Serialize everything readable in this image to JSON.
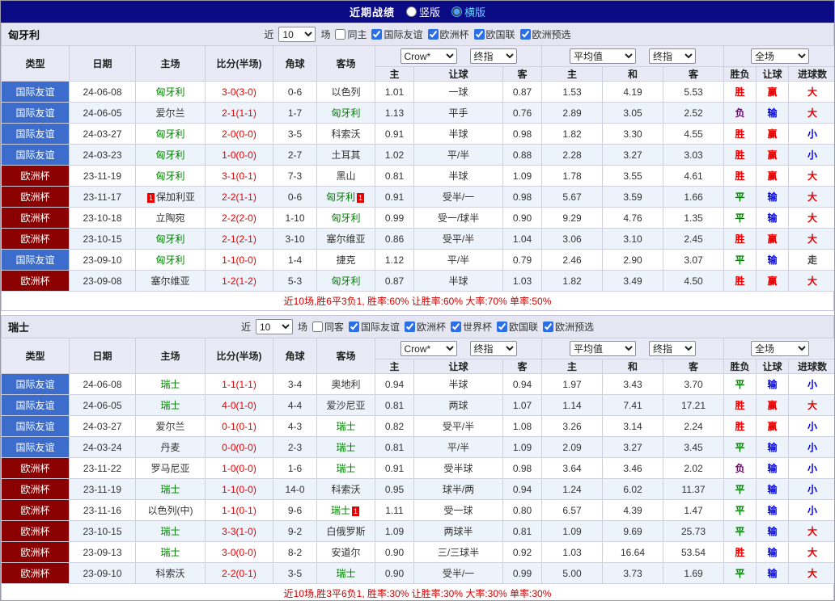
{
  "topbar": {
    "title": "近期战绩",
    "vertical_label": "竖版",
    "horizontal_label": "横版",
    "vertical_checked": false,
    "horizontal_checked": true
  },
  "filter_words": {
    "near": "近",
    "count": "10",
    "games": "场"
  },
  "odds_headers": {
    "company": "Crow*",
    "final": "终指",
    "average": "平均值",
    "final2": "终指",
    "full": "全场"
  },
  "columns": [
    "类型",
    "日期",
    "主场",
    "比分(半场)",
    "角球",
    "客场",
    "主",
    "让球",
    "客",
    "主",
    "和",
    "客",
    "胜负",
    "让球",
    "进球数"
  ],
  "sections": [
    {
      "team": "匈牙利",
      "filter": {
        "same_label": "同主",
        "same_checked": false,
        "competitions": [
          {
            "label": "国际友谊",
            "checked": true
          },
          {
            "label": "欧洲杯",
            "checked": true
          },
          {
            "label": "欧国联",
            "checked": true
          },
          {
            "label": "欧洲预选",
            "checked": true
          }
        ]
      },
      "rows": [
        {
          "type": "国际友谊",
          "tc": "friendly",
          "date": "24-06-08",
          "home": "匈牙利",
          "hf": true,
          "hc": 0,
          "score": "3-0(3-0)",
          "corner": "0-6",
          "away": "以色列",
          "af": false,
          "ac": 0,
          "o1": "1.01",
          "line": "一球",
          "o2": "0.87",
          "eh": "1.53",
          "ed": "4.19",
          "ea": "5.53",
          "r": "胜",
          "rc": "win",
          "hr": "赢",
          "hrc": "win",
          "g": "大",
          "gc": "big"
        },
        {
          "type": "国际友谊",
          "tc": "friendly",
          "date": "24-06-05",
          "home": "爱尔兰",
          "hf": false,
          "hc": 0,
          "score": "2-1(1-1)",
          "corner": "1-7",
          "away": "匈牙利",
          "af": true,
          "ac": 0,
          "o1": "1.13",
          "line": "平手",
          "o2": "0.76",
          "eh": "2.89",
          "ed": "3.05",
          "ea": "2.52",
          "r": "负",
          "rc": "lose",
          "hr": "输",
          "hrc": "lose",
          "g": "大",
          "gc": "big"
        },
        {
          "type": "国际友谊",
          "tc": "friendly",
          "date": "24-03-27",
          "home": "匈牙利",
          "hf": true,
          "hc": 0,
          "score": "2-0(0-0)",
          "corner": "3-5",
          "away": "科索沃",
          "af": false,
          "ac": 0,
          "o1": "0.91",
          "line": "半球",
          "o2": "0.98",
          "eh": "1.82",
          "ed": "3.30",
          "ea": "4.55",
          "r": "胜",
          "rc": "win",
          "hr": "赢",
          "hrc": "win",
          "g": "小",
          "gc": "small"
        },
        {
          "type": "国际友谊",
          "tc": "friendly",
          "date": "24-03-23",
          "home": "匈牙利",
          "hf": true,
          "hc": 0,
          "score": "1-0(0-0)",
          "corner": "2-7",
          "away": "土耳其",
          "af": false,
          "ac": 0,
          "o1": "1.02",
          "line": "平/半",
          "o2": "0.88",
          "eh": "2.28",
          "ed": "3.27",
          "ea": "3.03",
          "r": "胜",
          "rc": "win",
          "hr": "赢",
          "hrc": "win",
          "g": "小",
          "gc": "small"
        },
        {
          "type": "欧洲杯",
          "tc": "euro",
          "date": "23-11-19",
          "home": "匈牙利",
          "hf": true,
          "hc": 0,
          "score": "3-1(0-1)",
          "corner": "7-3",
          "away": "黑山",
          "af": false,
          "ac": 0,
          "o1": "0.81",
          "line": "半球",
          "o2": "1.09",
          "eh": "1.78",
          "ed": "3.55",
          "ea": "4.61",
          "r": "胜",
          "rc": "win",
          "hr": "赢",
          "hrc": "win",
          "g": "大",
          "gc": "big"
        },
        {
          "type": "欧洲杯",
          "tc": "euro",
          "date": "23-11-17",
          "home": "保加利亚",
          "hf": false,
          "hc": 1,
          "score": "2-2(1-1)",
          "corner": "0-6",
          "away": "匈牙利",
          "af": true,
          "ac": 1,
          "o1": "0.91",
          "line": "受半/一",
          "o2": "0.98",
          "eh": "5.67",
          "ed": "3.59",
          "ea": "1.66",
          "r": "平",
          "rc": "draw",
          "hr": "输",
          "hrc": "lose",
          "g": "大",
          "gc": "big"
        },
        {
          "type": "欧洲杯",
          "tc": "euro",
          "date": "23-10-18",
          "home": "立陶宛",
          "hf": false,
          "hc": 0,
          "score": "2-2(2-0)",
          "corner": "1-10",
          "away": "匈牙利",
          "af": true,
          "ac": 0,
          "o1": "0.99",
          "line": "受一/球半",
          "o2": "0.90",
          "eh": "9.29",
          "ed": "4.76",
          "ea": "1.35",
          "r": "平",
          "rc": "draw",
          "hr": "输",
          "hrc": "lose",
          "g": "大",
          "gc": "big"
        },
        {
          "type": "欧洲杯",
          "tc": "euro",
          "date": "23-10-15",
          "home": "匈牙利",
          "hf": true,
          "hc": 0,
          "score": "2-1(2-1)",
          "corner": "3-10",
          "away": "塞尔维亚",
          "af": false,
          "ac": 0,
          "o1": "0.86",
          "line": "受平/半",
          "o2": "1.04",
          "eh": "3.06",
          "ed": "3.10",
          "ea": "2.45",
          "r": "胜",
          "rc": "win",
          "hr": "赢",
          "hrc": "win",
          "g": "大",
          "gc": "big"
        },
        {
          "type": "国际友谊",
          "tc": "friendly",
          "date": "23-09-10",
          "home": "匈牙利",
          "hf": true,
          "hc": 0,
          "score": "1-1(0-0)",
          "corner": "1-4",
          "away": "捷克",
          "af": false,
          "ac": 0,
          "o1": "1.12",
          "line": "平/半",
          "o2": "0.79",
          "eh": "2.46",
          "ed": "2.90",
          "ea": "3.07",
          "r": "平",
          "rc": "draw",
          "hr": "输",
          "hrc": "lose",
          "g": "走",
          "gc": "push"
        },
        {
          "type": "欧洲杯",
          "tc": "euro",
          "date": "23-09-08",
          "home": "塞尔维亚",
          "hf": false,
          "hc": 0,
          "score": "1-2(1-2)",
          "corner": "5-3",
          "away": "匈牙利",
          "af": true,
          "ac": 0,
          "o1": "0.87",
          "line": "半球",
          "o2": "1.03",
          "eh": "1.82",
          "ed": "3.49",
          "ea": "4.50",
          "r": "胜",
          "rc": "win",
          "hr": "赢",
          "hrc": "win",
          "g": "大",
          "gc": "big"
        }
      ],
      "summary": "近10场,胜6平3负1, 胜率:60% 让胜率:60% 大率:70% 单率:50%"
    },
    {
      "team": "瑞士",
      "filter": {
        "same_label": "同客",
        "same_checked": false,
        "competitions": [
          {
            "label": "国际友谊",
            "checked": true
          },
          {
            "label": "欧洲杯",
            "checked": true
          },
          {
            "label": "世界杯",
            "checked": true
          },
          {
            "label": "欧国联",
            "checked": true
          },
          {
            "label": "欧洲预选",
            "checked": true
          }
        ]
      },
      "rows": [
        {
          "type": "国际友谊",
          "tc": "friendly",
          "date": "24-06-08",
          "home": "瑞士",
          "hf": true,
          "hc": 0,
          "score": "1-1(1-1)",
          "corner": "3-4",
          "away": "奥地利",
          "af": false,
          "ac": 0,
          "o1": "0.94",
          "line": "半球",
          "o2": "0.94",
          "eh": "1.97",
          "ed": "3.43",
          "ea": "3.70",
          "r": "平",
          "rc": "draw",
          "hr": "输",
          "hrc": "lose",
          "g": "小",
          "gc": "small"
        },
        {
          "type": "国际友谊",
          "tc": "friendly",
          "date": "24-06-05",
          "home": "瑞士",
          "hf": true,
          "hc": 0,
          "score": "4-0(1-0)",
          "corner": "4-4",
          "away": "爱沙尼亚",
          "af": false,
          "ac": 0,
          "o1": "0.81",
          "line": "两球",
          "o2": "1.07",
          "eh": "1.14",
          "ed": "7.41",
          "ea": "17.21",
          "r": "胜",
          "rc": "win",
          "hr": "赢",
          "hrc": "win",
          "g": "大",
          "gc": "big"
        },
        {
          "type": "国际友谊",
          "tc": "friendly",
          "date": "24-03-27",
          "home": "爱尔兰",
          "hf": false,
          "hc": 0,
          "score": "0-1(0-1)",
          "corner": "4-3",
          "away": "瑞士",
          "af": true,
          "ac": 0,
          "o1": "0.82",
          "line": "受平/半",
          "o2": "1.08",
          "eh": "3.26",
          "ed": "3.14",
          "ea": "2.24",
          "r": "胜",
          "rc": "win",
          "hr": "赢",
          "hrc": "win",
          "g": "小",
          "gc": "small"
        },
        {
          "type": "国际友谊",
          "tc": "friendly",
          "date": "24-03-24",
          "home": "丹麦",
          "hf": false,
          "hc": 0,
          "score": "0-0(0-0)",
          "corner": "2-3",
          "away": "瑞士",
          "af": true,
          "ac": 0,
          "o1": "0.81",
          "line": "平/半",
          "o2": "1.09",
          "eh": "2.09",
          "ed": "3.27",
          "ea": "3.45",
          "r": "平",
          "rc": "draw",
          "hr": "输",
          "hrc": "lose",
          "g": "小",
          "gc": "small"
        },
        {
          "type": "欧洲杯",
          "tc": "euro",
          "date": "23-11-22",
          "home": "罗马尼亚",
          "hf": false,
          "hc": 0,
          "score": "1-0(0-0)",
          "corner": "1-6",
          "away": "瑞士",
          "af": true,
          "ac": 0,
          "o1": "0.91",
          "line": "受半球",
          "o2": "0.98",
          "eh": "3.64",
          "ed": "3.46",
          "ea": "2.02",
          "r": "负",
          "rc": "lose",
          "hr": "输",
          "hrc": "lose",
          "g": "小",
          "gc": "small"
        },
        {
          "type": "欧洲杯",
          "tc": "euro",
          "date": "23-11-19",
          "home": "瑞士",
          "hf": true,
          "hc": 0,
          "score": "1-1(0-0)",
          "corner": "14-0",
          "away": "科索沃",
          "af": false,
          "ac": 0,
          "o1": "0.95",
          "line": "球半/两",
          "o2": "0.94",
          "eh": "1.24",
          "ed": "6.02",
          "ea": "11.37",
          "r": "平",
          "rc": "draw",
          "hr": "输",
          "hrc": "lose",
          "g": "小",
          "gc": "small"
        },
        {
          "type": "欧洲杯",
          "tc": "euro",
          "date": "23-11-16",
          "home": "以色列(中)",
          "hf": false,
          "hc": 0,
          "score": "1-1(0-1)",
          "corner": "9-6",
          "away": "瑞士",
          "af": true,
          "ac": 1,
          "o1": "1.11",
          "line": "受一球",
          "o2": "0.80",
          "eh": "6.57",
          "ed": "4.39",
          "ea": "1.47",
          "r": "平",
          "rc": "draw",
          "hr": "输",
          "hrc": "lose",
          "g": "小",
          "gc": "small"
        },
        {
          "type": "欧洲杯",
          "tc": "euro",
          "date": "23-10-15",
          "home": "瑞士",
          "hf": true,
          "hc": 0,
          "score": "3-3(1-0)",
          "corner": "9-2",
          "away": "白俄罗斯",
          "af": false,
          "ac": 0,
          "o1": "1.09",
          "line": "两球半",
          "o2": "0.81",
          "eh": "1.09",
          "ed": "9.69",
          "ea": "25.73",
          "r": "平",
          "rc": "draw",
          "hr": "输",
          "hrc": "lose",
          "g": "大",
          "gc": "big"
        },
        {
          "type": "欧洲杯",
          "tc": "euro",
          "date": "23-09-13",
          "home": "瑞士",
          "hf": true,
          "hc": 0,
          "score": "3-0(0-0)",
          "corner": "8-2",
          "away": "安道尔",
          "af": false,
          "ac": 0,
          "o1": "0.90",
          "line": "三/三球半",
          "o2": "0.92",
          "eh": "1.03",
          "ed": "16.64",
          "ea": "53.54",
          "r": "胜",
          "rc": "win",
          "hr": "输",
          "hrc": "lose",
          "g": "大",
          "gc": "big"
        },
        {
          "type": "欧洲杯",
          "tc": "euro",
          "date": "23-09-10",
          "home": "科索沃",
          "hf": false,
          "hc": 0,
          "score": "2-2(0-1)",
          "corner": "3-5",
          "away": "瑞士",
          "af": true,
          "ac": 0,
          "o1": "0.90",
          "line": "受半/一",
          "o2": "0.99",
          "eh": "5.00",
          "ed": "3.73",
          "ea": "1.69",
          "r": "平",
          "rc": "draw",
          "hr": "输",
          "hrc": "lose",
          "g": "大",
          "gc": "big"
        }
      ],
      "summary": "近10场,胜3平6负1, 胜率:30% 让胜率:30% 大率:30% 单率:30%"
    }
  ],
  "colors": {
    "topbar_bg": "#0b0b85",
    "band_bg": "#e6e6f2",
    "header_bg": "#eaeaf6",
    "row_alt": "#edf3fb",
    "friendly_bg": "#3d6dcc",
    "eurocup_bg": "#8b0000",
    "focus_team": "#008000",
    "score": "#e60000",
    "win": "#e60000",
    "draw": "#008000",
    "lose": "#800080",
    "under": "#0000ee",
    "push": "#444444",
    "summary": "#d00000",
    "horizontal_label": "#66ccff"
  }
}
